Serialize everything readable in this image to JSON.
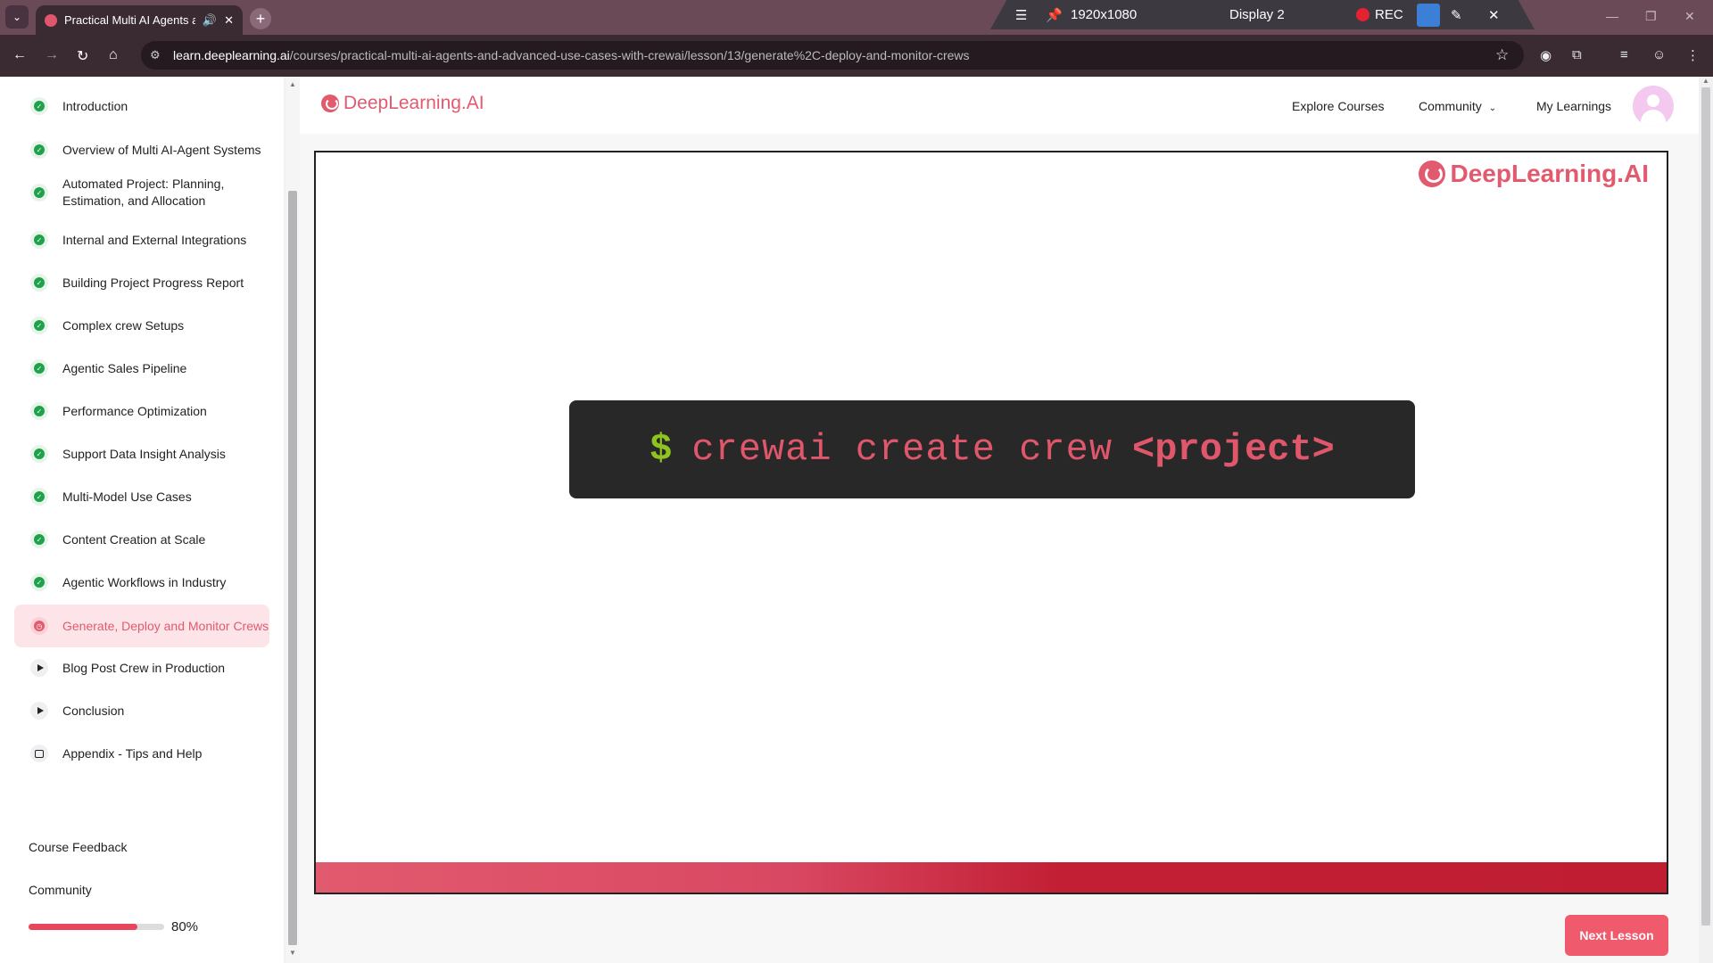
{
  "browser": {
    "tab_title": "Practical Multi AI Agents and Advanced Use Cases",
    "url_host": "learn.deeplearning.ai",
    "url_path": "/courses/practical-multi-ai-agents-and-advanced-use-cases-with-crewai/lesson/13/generate%2C-deploy-and-monitor-crews"
  },
  "recorder": {
    "resolution": "1920x1080",
    "display": "Display 2",
    "rec_label": "REC"
  },
  "brand": {
    "name": "DeepLearning.AI",
    "color": "#e25a6e"
  },
  "nav": {
    "explore": "Explore Courses",
    "community": "Community",
    "my_learnings": "My Learnings"
  },
  "lessons": [
    {
      "label": "Introduction",
      "status": "completed"
    },
    {
      "label": "Overview of Multi AI-Agent Systems",
      "status": "completed"
    },
    {
      "label": "Automated Project: Planning, Estimation, and Allocation",
      "status": "completed"
    },
    {
      "label": "Internal and External Integrations",
      "status": "completed"
    },
    {
      "label": "Building Project Progress Report",
      "status": "completed"
    },
    {
      "label": "Complex crew Setups",
      "status": "completed"
    },
    {
      "label": "Agentic Sales Pipeline",
      "status": "completed"
    },
    {
      "label": "Performance Optimization",
      "status": "completed"
    },
    {
      "label": "Support Data Insight Analysis",
      "status": "completed"
    },
    {
      "label": "Multi-Model Use Cases",
      "status": "completed"
    },
    {
      "label": "Content Creation at Scale",
      "status": "completed"
    },
    {
      "label": "Agentic Workflows in Industry",
      "status": "completed"
    },
    {
      "label": "Generate, Deploy and Monitor Crews",
      "status": "current"
    },
    {
      "label": "Blog Post Crew in Production",
      "status": "video"
    },
    {
      "label": "Conclusion",
      "status": "video"
    },
    {
      "label": "Appendix - Tips and Help",
      "status": "reading"
    }
  ],
  "sidebar": {
    "feedback": "Course Feedback",
    "community": "Community",
    "progress_label": "80%",
    "progress_value": 0.8
  },
  "video": {
    "terminal": {
      "prompt": "$",
      "command": "crewai create crew",
      "argument": "<project>"
    }
  },
  "footer": {
    "next_label": "Next Lesson"
  },
  "colors": {
    "accent": "#e25a6e",
    "completed": "#1fa34a",
    "terminal_bg": "#282828",
    "terminal_prompt": "#8fc31f"
  }
}
